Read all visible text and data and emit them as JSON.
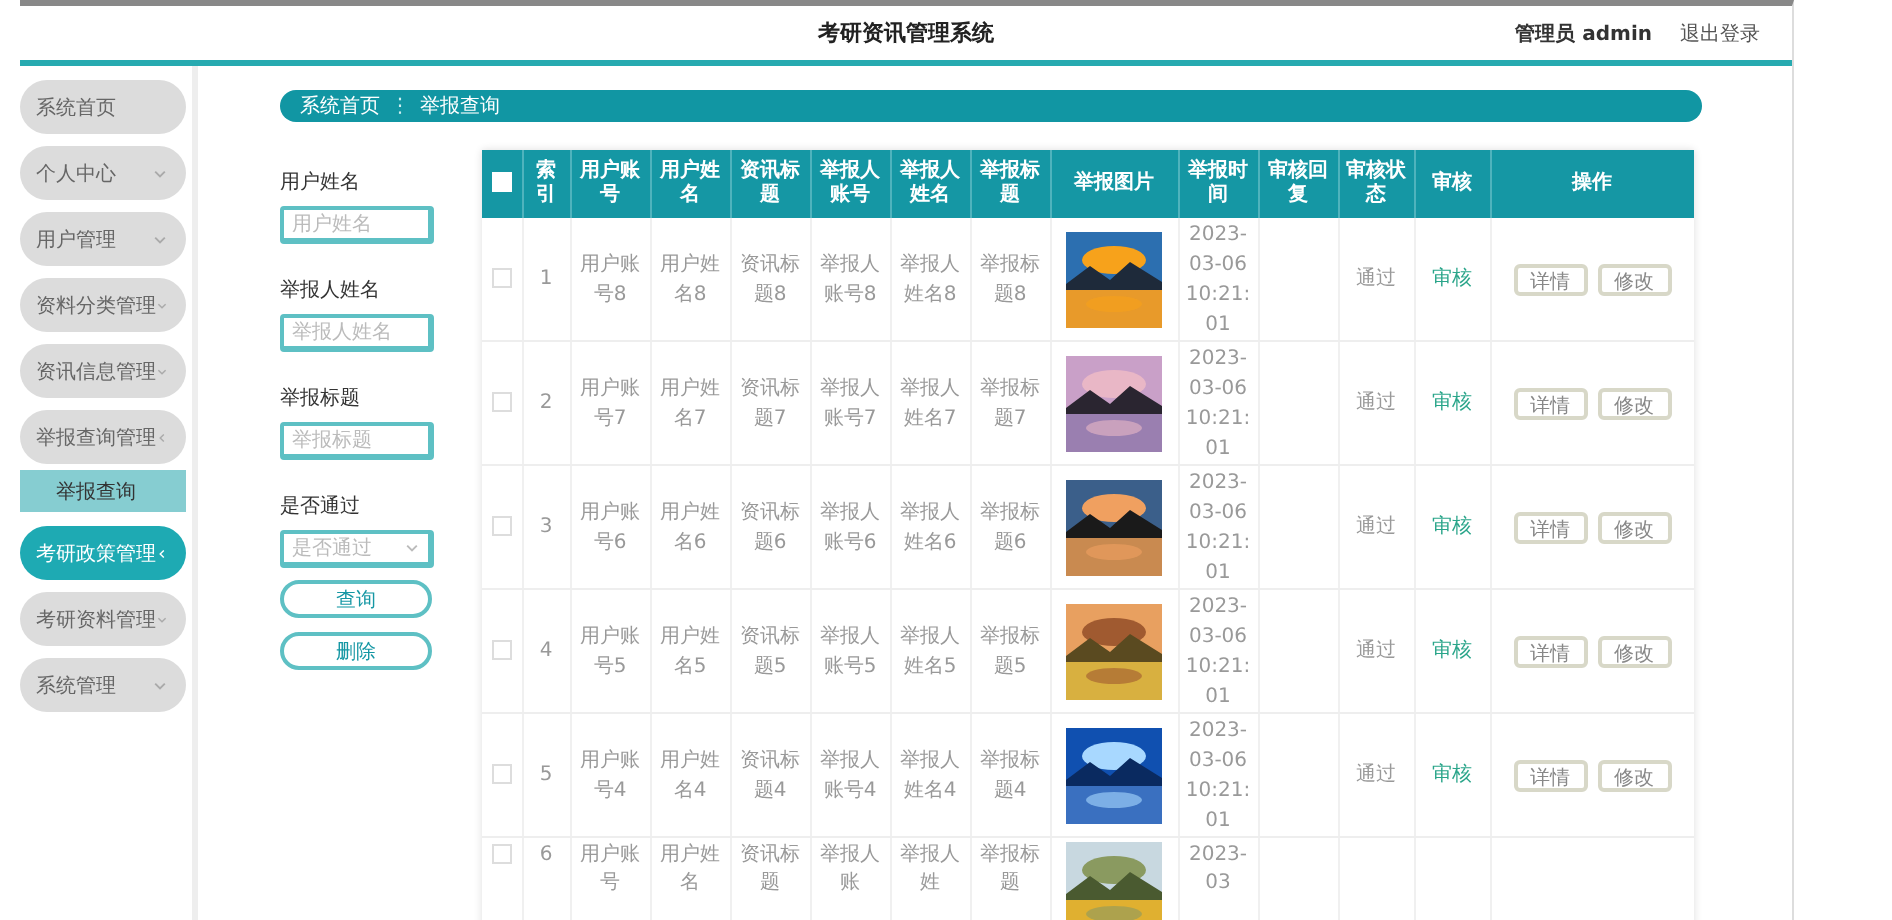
{
  "header": {
    "title": "考研资讯管理系统",
    "user": "管理员 admin",
    "logout": "退出登录"
  },
  "sidebar": {
    "items": [
      {
        "label": "系统首页",
        "selected": false
      },
      {
        "label": "个人中心",
        "selected": false,
        "expanded": false
      },
      {
        "label": "用户管理",
        "selected": false,
        "expanded": false
      },
      {
        "label": "资料分类管理",
        "selected": false,
        "expanded": false
      },
      {
        "label": "资讯信息管理",
        "selected": false,
        "expanded": false
      },
      {
        "label": "举报查询管理",
        "selected": false,
        "expanded": true,
        "children": [
          {
            "label": "举报查询"
          }
        ]
      },
      {
        "label": "考研政策管理",
        "selected": true,
        "expanded": true
      },
      {
        "label": "考研资料管理",
        "selected": false,
        "expanded": false
      },
      {
        "label": "系统管理",
        "selected": false,
        "expanded": false
      }
    ]
  },
  "breadcrumb": {
    "items": [
      "系统首页",
      "举报查询"
    ],
    "separator": "⋮"
  },
  "search_form": {
    "fields": [
      {
        "kind": "text",
        "label": "用户姓名",
        "placeholder": "用户姓名"
      },
      {
        "kind": "text",
        "label": "举报人姓名",
        "placeholder": "举报人姓名"
      },
      {
        "kind": "text",
        "label": "举报标题",
        "placeholder": "举报标题"
      },
      {
        "kind": "select",
        "label": "是否通过",
        "placeholder": "是否通过"
      }
    ],
    "buttons": [
      "查询",
      "删除"
    ]
  },
  "table": {
    "select_all": {
      "checked": false
    },
    "columns": [
      "索引",
      "用户账号",
      "用户姓名",
      "资讯标题",
      "举报人账号",
      "举报人姓名",
      "举报标题",
      "举报图片",
      "举报时间",
      "审核回复",
      "审核状态",
      "审核",
      "操作"
    ],
    "rows": [
      {
        "checked": false,
        "cells": [
          "1",
          "用户账号8",
          "用户姓名8",
          "资讯标题8",
          "举报人账号8",
          "举报人姓名8",
          "举报标题8",
          "2023-03-06 10:21:01",
          "",
          "通过"
        ],
        "review": "审核",
        "actions": [
          "详情",
          "修改"
        ]
      },
      {
        "checked": false,
        "cells": [
          "2",
          "用户账号7",
          "用户姓名7",
          "资讯标题7",
          "举报人账号7",
          "举报人姓名7",
          "举报标题7",
          "2023-03-06 10:21:01",
          "",
          "通过"
        ],
        "review": "审核",
        "actions": [
          "详情",
          "修改"
        ]
      },
      {
        "checked": false,
        "cells": [
          "3",
          "用户账号6",
          "用户姓名6",
          "资讯标题6",
          "举报人账号6",
          "举报人姓名6",
          "举报标题6",
          "2023-03-06 10:21:01",
          "",
          "通过"
        ],
        "review": "审核",
        "actions": [
          "详情",
          "修改"
        ]
      },
      {
        "checked": false,
        "cells": [
          "4",
          "用户账号5",
          "用户姓名5",
          "资讯标题5",
          "举报人账号5",
          "举报人姓名5",
          "举报标题5",
          "2023-03-06 10:21:01",
          "",
          "通过"
        ],
        "review": "审核",
        "actions": [
          "详情",
          "修改"
        ]
      },
      {
        "checked": false,
        "cells": [
          "5",
          "用户账号4",
          "用户姓名4",
          "资讯标题4",
          "举报人账号4",
          "举报人姓名4",
          "举报标题4",
          "2023-03-06 10:21:01",
          "",
          "通过"
        ],
        "review": "审核",
        "actions": [
          "详情",
          "修改"
        ]
      },
      {
        "checked": false,
        "cells": [
          "6",
          "用户账号",
          "用户姓名",
          "资讯标题",
          "举报人账",
          "举报人姓",
          "举报标题",
          "2023-03",
          "",
          ""
        ]
      }
    ]
  }
}
